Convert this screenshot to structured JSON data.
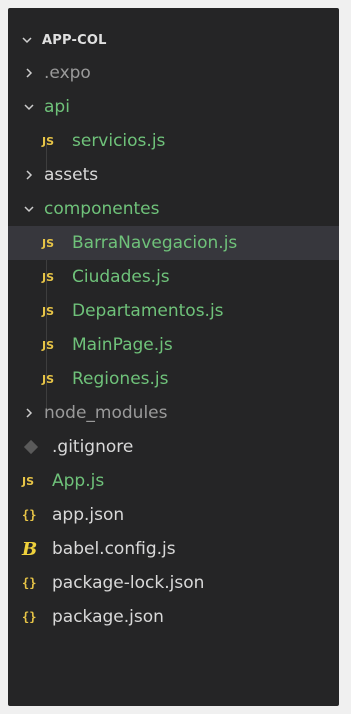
{
  "explorer": {
    "root_label": "APP-COL",
    "items": [
      {
        "label": ".expo",
        "type": "folder",
        "expanded": false,
        "status": "muted",
        "depth": 1
      },
      {
        "label": "api",
        "type": "folder",
        "expanded": true,
        "status": "green",
        "depth": 1
      },
      {
        "label": "servicios.js",
        "type": "file",
        "icon": "js-icon",
        "badge": "JS",
        "status": "green",
        "depth": 2
      },
      {
        "label": "assets",
        "type": "folder",
        "expanded": false,
        "status": "white",
        "depth": 1
      },
      {
        "label": "componentes",
        "type": "folder",
        "expanded": true,
        "status": "green",
        "depth": 1
      },
      {
        "label": "BarraNavegacion.js",
        "type": "file",
        "icon": "js-icon",
        "badge": "JS",
        "status": "green",
        "depth": 2,
        "selected": true
      },
      {
        "label": "Ciudades.js",
        "type": "file",
        "icon": "js-icon",
        "badge": "JS",
        "status": "green",
        "depth": 2
      },
      {
        "label": "Departamentos.js",
        "type": "file",
        "icon": "js-icon",
        "badge": "JS",
        "status": "green",
        "depth": 2
      },
      {
        "label": "MainPage.js",
        "type": "file",
        "icon": "js-icon",
        "badge": "JS",
        "status": "green",
        "depth": 2
      },
      {
        "label": "Regiones.js",
        "type": "file",
        "icon": "js-icon",
        "badge": "JS",
        "status": "green",
        "depth": 2
      },
      {
        "label": "node_modules",
        "type": "folder",
        "expanded": false,
        "status": "muted",
        "depth": 1
      },
      {
        "label": ".gitignore",
        "type": "file",
        "icon": "git-icon",
        "status": "white",
        "depth": 1
      },
      {
        "label": "App.js",
        "type": "file",
        "icon": "js-icon",
        "badge": "JS",
        "status": "green",
        "depth": 1
      },
      {
        "label": "app.json",
        "type": "file",
        "icon": "json-icon",
        "badge": "{}",
        "status": "white",
        "depth": 1
      },
      {
        "label": "babel.config.js",
        "type": "file",
        "icon": "babel-icon",
        "badge": "B",
        "status": "white",
        "depth": 1
      },
      {
        "label": "package-lock.json",
        "type": "file",
        "icon": "json-icon",
        "badge": "{}",
        "status": "white",
        "depth": 1
      },
      {
        "label": "package.json",
        "type": "file",
        "icon": "json-icon",
        "badge": "{}",
        "status": "white",
        "depth": 1
      }
    ]
  },
  "colors": {
    "background": "#252526",
    "selected": "#37373d",
    "modified": "#6fc27a",
    "muted": "#9a9a9a",
    "js_badge": "#e8c547"
  }
}
